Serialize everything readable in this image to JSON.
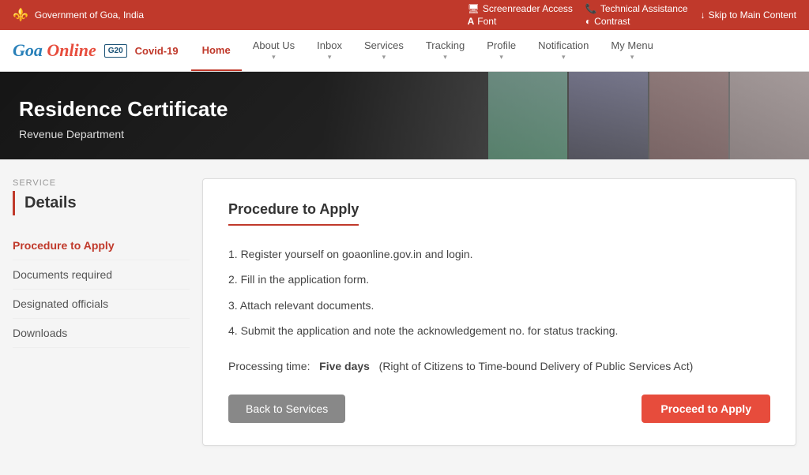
{
  "topbar": {
    "gov_name": "Government of Goa, India",
    "screenreader": "Screenreader Access",
    "technical": "Technical Assistance",
    "font": "Font",
    "contrast": "Contrast",
    "skip": "Skip to Main Content"
  },
  "nav": {
    "logo_text": "Goa Online",
    "covid_label": "Covid-19",
    "items": [
      {
        "label": "Home",
        "active": true,
        "has_dropdown": false
      },
      {
        "label": "About Us",
        "active": false,
        "has_dropdown": true
      },
      {
        "label": "Inbox",
        "active": false,
        "has_dropdown": true
      },
      {
        "label": "Services",
        "active": false,
        "has_dropdown": true
      },
      {
        "label": "Tracking",
        "active": false,
        "has_dropdown": true
      },
      {
        "label": "Profile",
        "active": false,
        "has_dropdown": true
      },
      {
        "label": "Notification",
        "active": false,
        "has_dropdown": true
      },
      {
        "label": "My Menu",
        "active": false,
        "has_dropdown": true
      }
    ]
  },
  "hero": {
    "title": "Residence Certificate",
    "subtitle": "Revenue Department"
  },
  "sidebar": {
    "service_label": "SERVICE",
    "service_title": "Details",
    "menu": [
      {
        "label": "Procedure to Apply",
        "active": true
      },
      {
        "label": "Documents required",
        "active": false
      },
      {
        "label": "Designated officials",
        "active": false
      },
      {
        "label": "Downloads",
        "active": false
      }
    ]
  },
  "content": {
    "section_title": "Procedure to Apply",
    "steps": [
      "1. Register yourself on goaonline.gov.in and login.",
      "2. Fill in the application form.",
      "3. Attach relevant documents.",
      "4. Submit the application and note the acknowledgement no. for status tracking."
    ],
    "processing_label": "Processing time:",
    "processing_highlight": "Five days",
    "processing_note": "(Right of Citizens to Time-bound Delivery of Public Services Act)",
    "btn_back": "Back to Services",
    "btn_proceed": "Proceed to Apply"
  }
}
